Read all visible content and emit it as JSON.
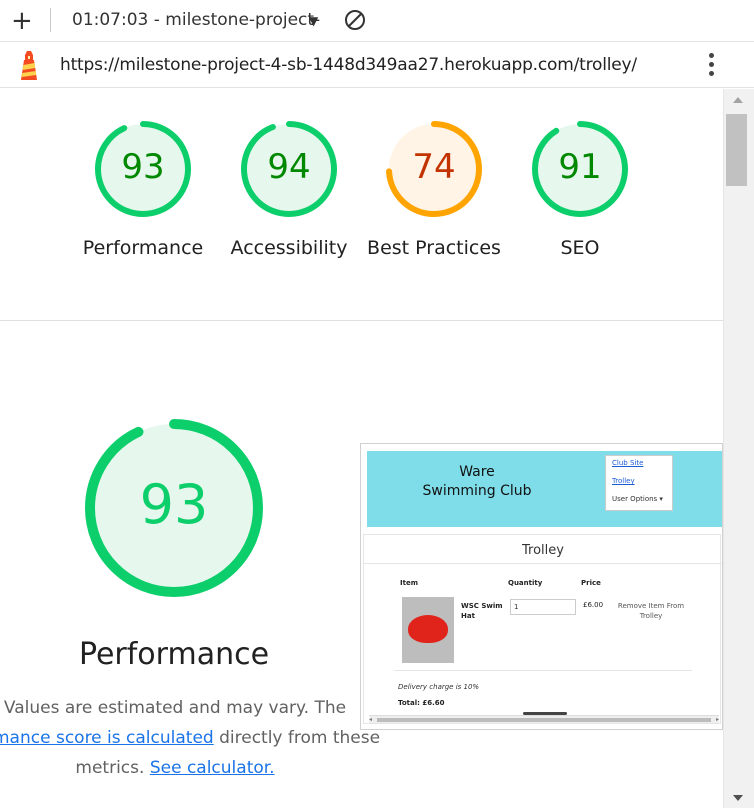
{
  "toolbar": {
    "new_tab_icon": "plus-icon",
    "tab_title": "01:07:03 - milestone-project-",
    "dropdown_icon": "caret-down-icon",
    "block_icon": "block-icon"
  },
  "address_bar": {
    "site_icon": "lighthouse-icon",
    "url": "https://milestone-project-4-sb-1448d349aa27.herokuapp.com/trolley/",
    "menu_icon": "kebab-menu-icon"
  },
  "scores": [
    {
      "value": "93",
      "label": "Performance",
      "fraction": 0.93,
      "color": "#0cce6b",
      "text_color": "#008800",
      "fill": "#e6f8ed"
    },
    {
      "value": "94",
      "label": "Accessibility",
      "fraction": 0.94,
      "color": "#0cce6b",
      "text_color": "#008800",
      "fill": "#e6f8ed"
    },
    {
      "value": "74",
      "label": "Best Practices",
      "fraction": 0.74,
      "color": "#ffa400",
      "text_color": "#c33300",
      "fill": "#fff4e6"
    },
    {
      "value": "91",
      "label": "SEO",
      "fraction": 0.91,
      "color": "#0cce6b",
      "text_color": "#008800",
      "fill": "#e6f8ed"
    }
  ],
  "main_score": {
    "value": "93",
    "fraction": 0.93,
    "label": "Performance",
    "color": "#0cce6b",
    "fill": "#e6f8ed"
  },
  "description": {
    "line1": "Values are estimated and may vary. The",
    "link1": "formance score is calculated",
    "mid": " directly from these",
    "line3_prefix": "metrics. ",
    "link2": "See calculator."
  },
  "screenshot": {
    "brand_line1": "Ware",
    "brand_line2": "Swimming Club",
    "menu_club_site": "Club Site",
    "menu_trolley": "Trolley",
    "menu_user_options": "User Options ▾",
    "page_title": "Trolley",
    "col_item": "Item",
    "col_quantity": "Quantity",
    "col_price": "Price",
    "item_name": "WSC Swim Hat",
    "item_qty": "1",
    "item_price": "£6.00",
    "remove_label": "Remove Item From Trolley",
    "delivery_note": "Delivery charge is 10%",
    "total": "Total: £6.60"
  }
}
